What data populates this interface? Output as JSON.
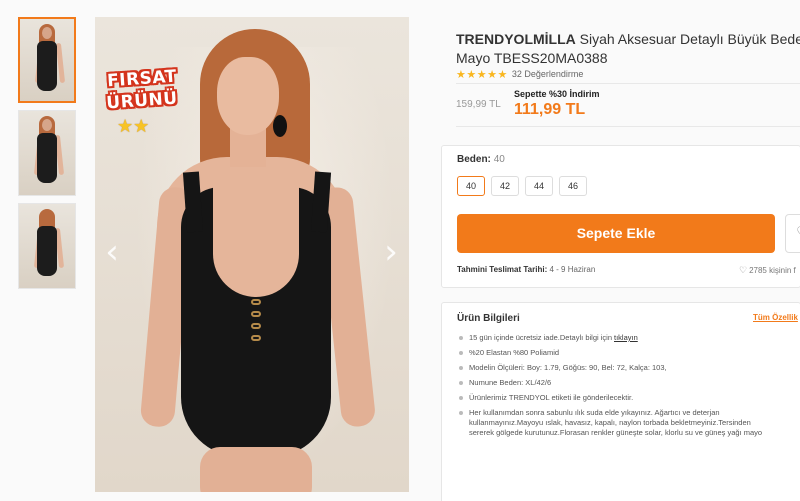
{
  "gallery": {
    "thumbnails": [
      {
        "name": "thumb-front"
      },
      {
        "name": "thumb-side"
      },
      {
        "name": "thumb-back"
      }
    ],
    "badge": {
      "line1": "FIRSAT",
      "line2": "ÜRÜNÜ"
    }
  },
  "product": {
    "brand": "TRENDYOLMİLLA",
    "title_line1": "Siyah Aksesuar Detaylı Büyük Beden",
    "title_line2": "Mayo TBESS20MA0388",
    "rating_count": "32 Değerlendirme",
    "stars": 5,
    "old_price": "159,99 TL",
    "discount_text": "Sepette %30 İndirim",
    "new_price": "111,99 TL"
  },
  "size": {
    "label": "Beden:",
    "selected": "40",
    "options": [
      "40",
      "42",
      "44",
      "46"
    ]
  },
  "actions": {
    "add_to_cart": "Sepete Ekle"
  },
  "delivery": {
    "label": "Tahmini Teslimat Tarihi:",
    "value": "4 - 9 Haziran",
    "likes": "2785 kişinin f"
  },
  "info": {
    "title": "Ürün Bilgileri",
    "all_features": "Tüm Özellik",
    "items": [
      {
        "text": "15 gün içinde ücretsiz iade.Detaylı bilgi için",
        "link": "tıklayın"
      },
      {
        "text": "%20 Elastan %80 Poliamid"
      },
      {
        "text": "Modelin Ölçüleri: Boy: 1.79, Göğüs: 90, Bel: 72, Kalça: 103,"
      },
      {
        "text": "Numune Beden: XL/42/6"
      },
      {
        "text": "Ürünlerimiz TRENDYOL etiketi ile gönderilecektir."
      },
      {
        "text": "Her kullanımdan sonra sabunlu ılık suda elde yıkayınız. Ağartıcı ve deterjan",
        "text2": "kullanmayınız.Mayoyu ıslak, havasız, kapalı, naylon torbada bekletmeyiniz.Tersinden",
        "text3": "sererek gölgede kurutunuz.Florasan renkler güneşte solar, klorlu su ve güneş yağı mayo"
      }
    ]
  },
  "colors": {
    "accent": "#f27a1a",
    "star": "#f9b61e"
  }
}
